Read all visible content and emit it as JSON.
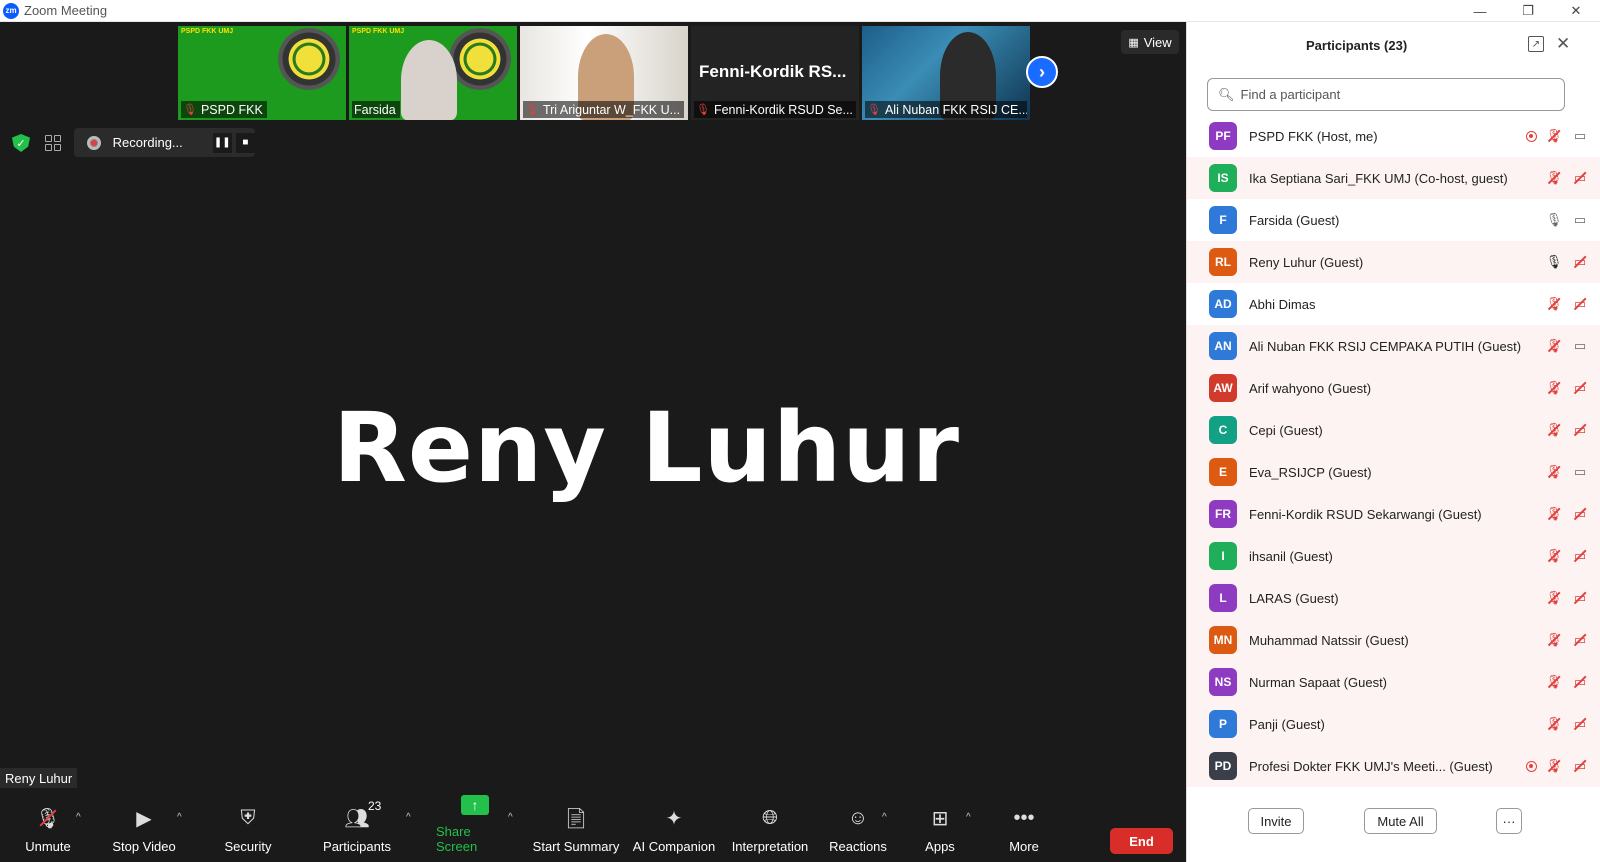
{
  "window": {
    "title": "Zoom Meeting",
    "logo_text": "zm",
    "controls": [
      "—",
      "❐",
      "✕"
    ]
  },
  "gallery": {
    "tiles": [
      {
        "label": "PSPD FKK",
        "muted": true,
        "style": "green",
        "header": "PSPD FKK UMJ"
      },
      {
        "label": "Farsida",
        "muted": false,
        "style": "green",
        "header": "PSPD FKK UMJ"
      },
      {
        "label": "Tri Ariguntar W_FKK U...",
        "muted": true,
        "style": "office"
      },
      {
        "label": "Fenni-Kordik RSUD Se...",
        "muted": true,
        "style": "dark",
        "big_name": "Fenni-Kordik  RS..."
      },
      {
        "label": "Ali Nuban FKK RSIJ CE...",
        "muted": true,
        "style": "ocean"
      }
    ],
    "next_arrow": "›",
    "view_label": "View"
  },
  "recording": {
    "label": "Recording...",
    "pause_glyph": "❚❚",
    "stop_glyph": "■"
  },
  "active_speaker": {
    "name": "Reny Luhur",
    "name_tag": "Reny Luhur"
  },
  "toolbar": {
    "unmute": "Unmute",
    "stop_video": "Stop Video",
    "security": "Security",
    "participants": "Participants",
    "participants_count": "23",
    "share_screen": "Share Screen",
    "start_summary": "Start Summary",
    "ai_companion": "AI Companion",
    "interpretation": "Interpretation",
    "reactions": "Reactions",
    "apps": "Apps",
    "more": "More",
    "end": "End",
    "share_color": "#23c04b",
    "end_color": "#d92d2a"
  },
  "panel": {
    "title": "Participants (23)",
    "search_placeholder": "Find a participant",
    "participants": [
      {
        "initials": "PF",
        "name": "PSPD FKK (Host, me)",
        "color": "#8e3bc1",
        "mic": "muted",
        "video": "on",
        "recording": true,
        "highlight": false
      },
      {
        "initials": "IS",
        "name": "Ika Septiana Sari_FKK UMJ (Co-host, guest)",
        "color": "#1fae5a",
        "mic": "muted",
        "video": "off",
        "recording": false,
        "highlight": true
      },
      {
        "initials": "F",
        "name": "Farsida (Guest)",
        "color": "#2f7ad8",
        "mic": "on",
        "video": "on",
        "recording": false,
        "highlight": false
      },
      {
        "initials": "RL",
        "name": "Reny Luhur (Guest)",
        "color": "#dc5a12",
        "mic": "active",
        "video": "off",
        "recording": false,
        "highlight": true
      },
      {
        "initials": "AD",
        "name": "Abhi Dimas",
        "color": "#2f7ad8",
        "mic": "muted",
        "video": "off",
        "recording": false,
        "highlight": false
      },
      {
        "initials": "AN",
        "name": "Ali Nuban FKK RSIJ CEMPAKA PUTIH (Guest)",
        "color": "#2f7ad8",
        "mic": "muted",
        "video": "on",
        "recording": false,
        "highlight": true
      },
      {
        "initials": "AW",
        "name": "Arif wahyono (Guest)",
        "color": "#d23a2c",
        "mic": "muted",
        "video": "off",
        "recording": false,
        "highlight": true
      },
      {
        "initials": "C",
        "name": "Cepi (Guest)",
        "color": "#12a184",
        "mic": "muted",
        "video": "off",
        "recording": false,
        "highlight": true
      },
      {
        "initials": "E",
        "name": "Eva_RSIJCP (Guest)",
        "color": "#dc5a12",
        "mic": "muted",
        "video": "on",
        "recording": false,
        "highlight": true
      },
      {
        "initials": "FR",
        "name": "Fenni-Kordik RSUD Sekarwangi (Guest)",
        "color": "#8e3bc1",
        "mic": "muted",
        "video": "off",
        "recording": false,
        "highlight": true
      },
      {
        "initials": "I",
        "name": "ihsanil (Guest)",
        "color": "#1fae5a",
        "mic": "muted",
        "video": "off",
        "recording": false,
        "highlight": true
      },
      {
        "initials": "L",
        "name": "LARAS (Guest)",
        "color": "#8e3bc1",
        "mic": "muted",
        "video": "off",
        "recording": false,
        "highlight": true
      },
      {
        "initials": "MN",
        "name": "Muhammad Natssir (Guest)",
        "color": "#dc5a12",
        "mic": "muted",
        "video": "off",
        "recording": false,
        "highlight": true
      },
      {
        "initials": "NS",
        "name": "Nurman Sapaat (Guest)",
        "color": "#8e3bc1",
        "mic": "muted",
        "video": "off",
        "recording": false,
        "highlight": true
      },
      {
        "initials": "P",
        "name": "Panji (Guest)",
        "color": "#2f7ad8",
        "mic": "muted",
        "video": "off",
        "recording": false,
        "highlight": true
      },
      {
        "initials": "PD",
        "name": "Profesi Dokter FKK UMJ's Meeti...  (Guest)",
        "color": "#3a3f4a",
        "mic": "muted",
        "video": "off",
        "recording": true,
        "highlight": true
      }
    ],
    "invite": "Invite",
    "mute_all": "Mute All",
    "more": "···"
  }
}
